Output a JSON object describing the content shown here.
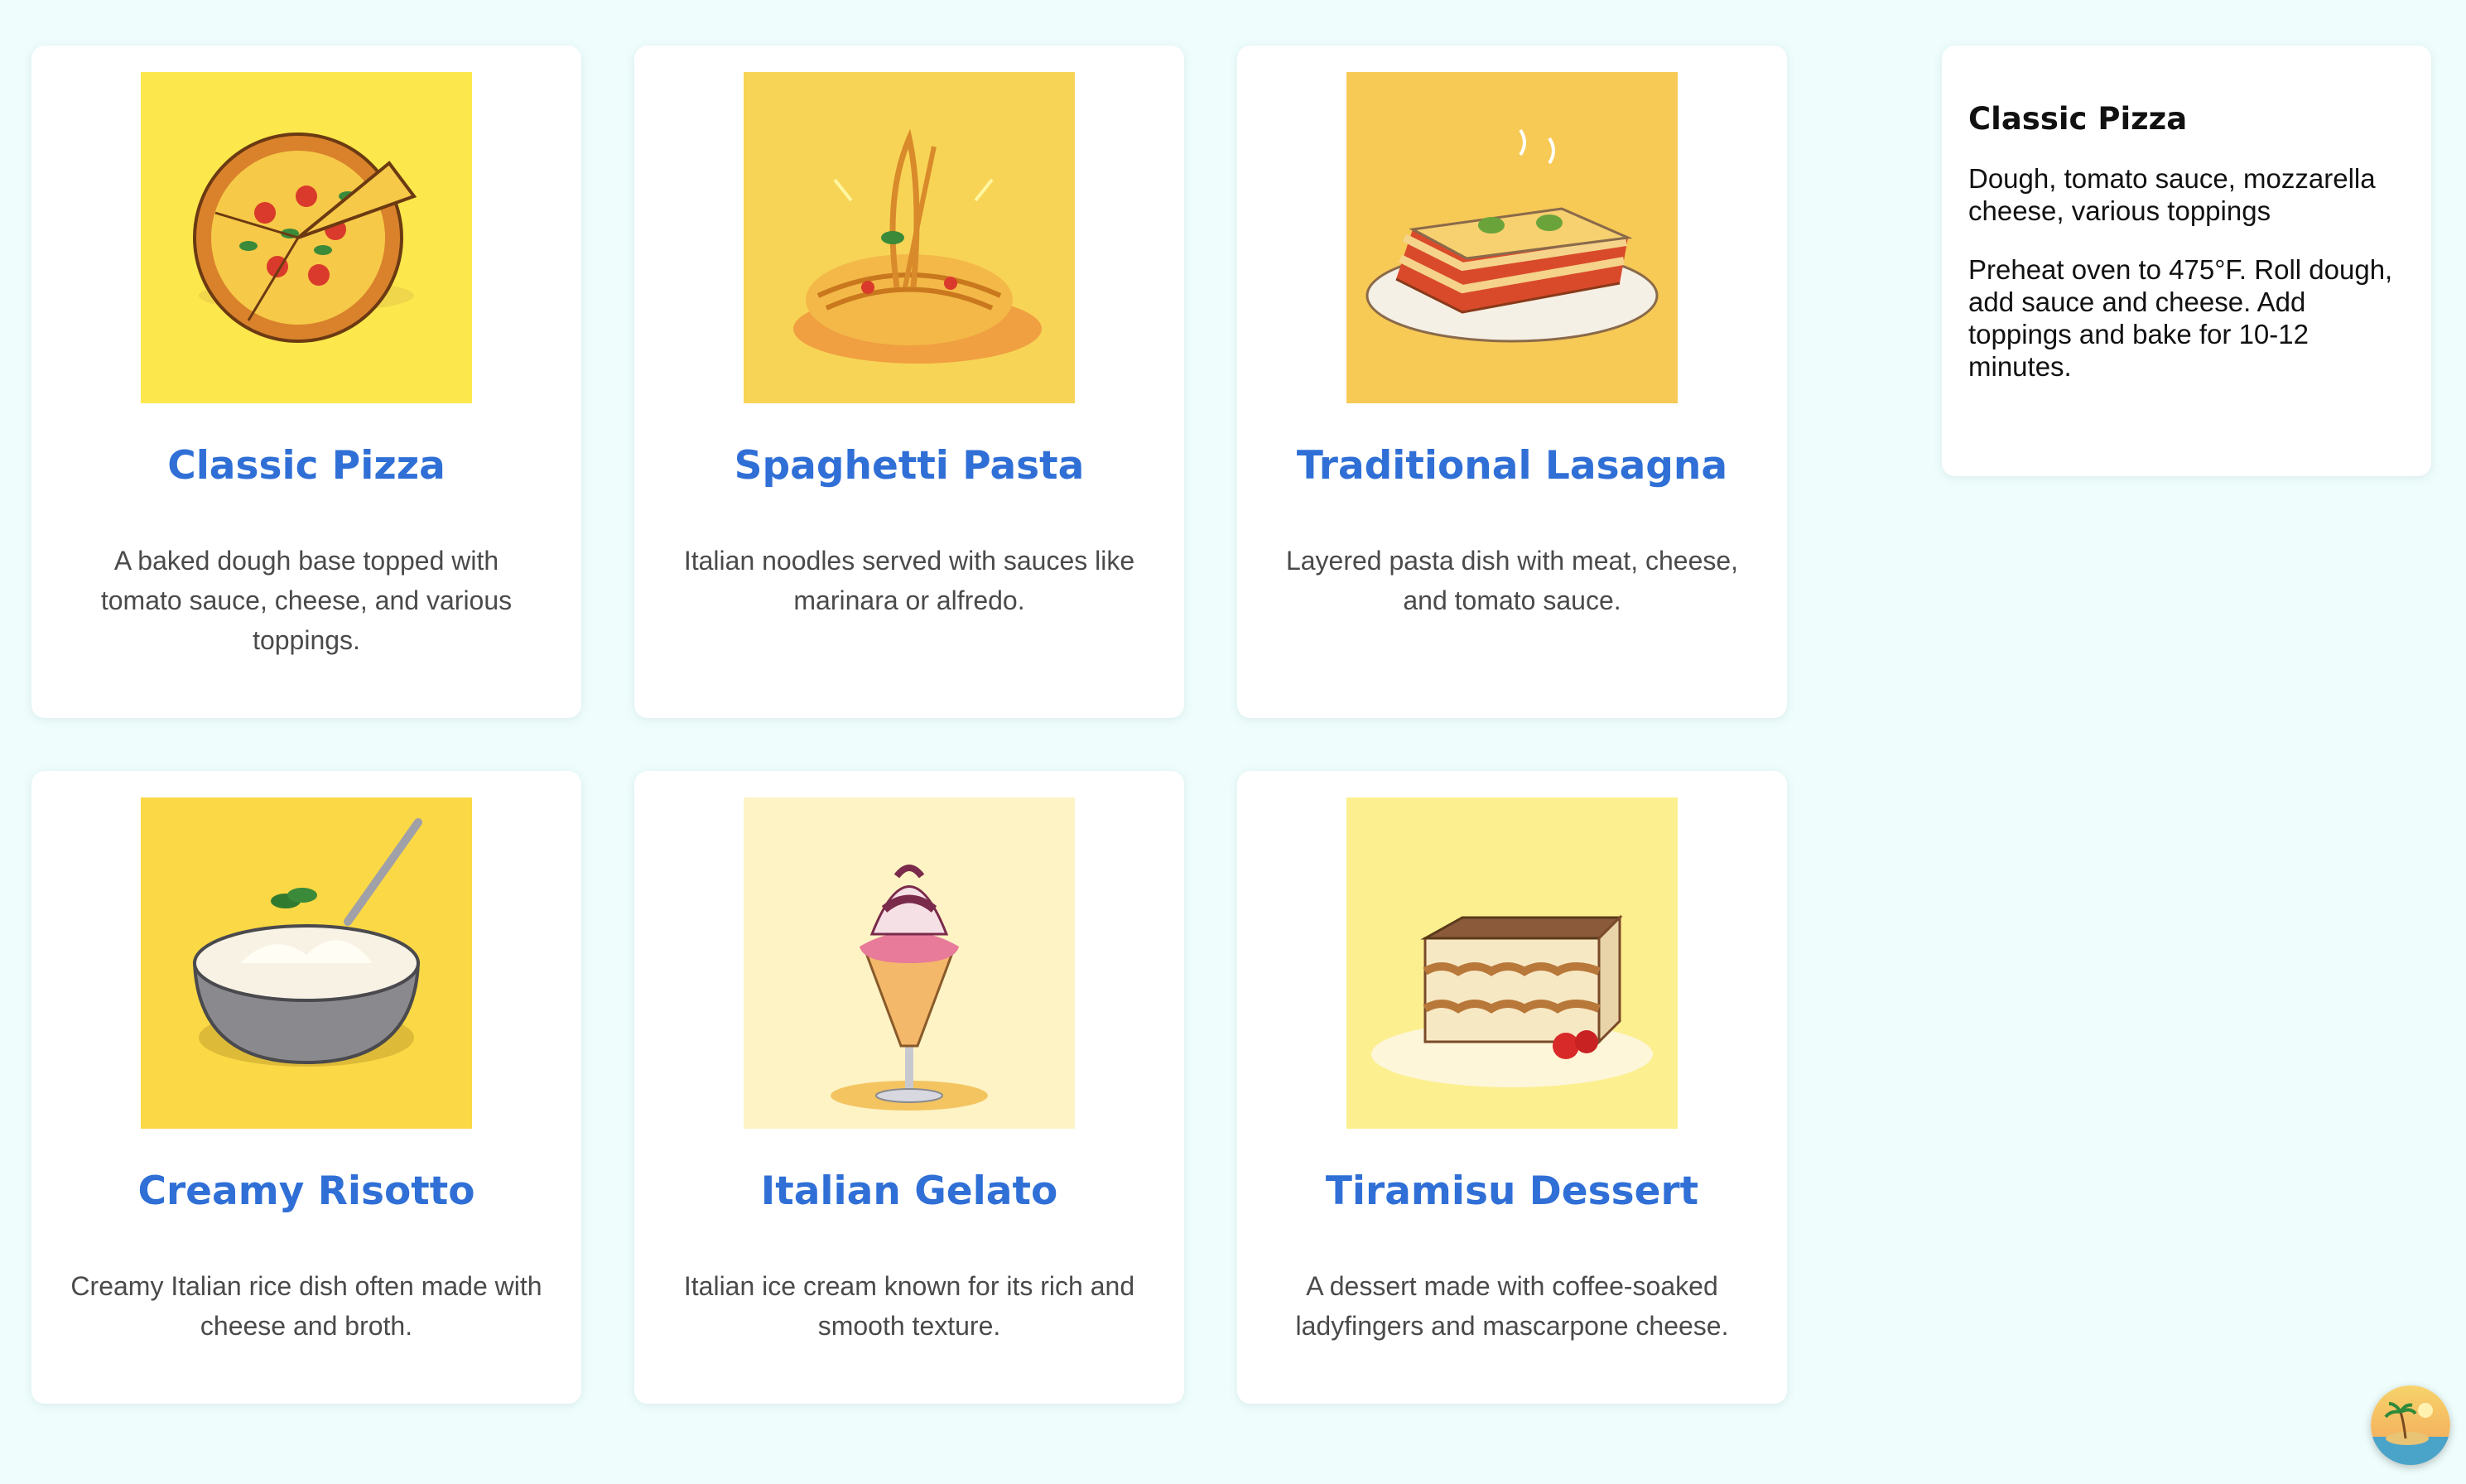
{
  "dishes": [
    {
      "title": "Classic Pizza",
      "description": "A baked dough base topped with tomato sauce, cheese, and various toppings.",
      "image_icon": "pizza-icon",
      "image_bg": "#fce84c"
    },
    {
      "title": "Spaghetti Pasta",
      "description": "Italian noodles served with sauces like marinara or alfredo.",
      "image_icon": "spaghetti-icon",
      "image_bg": "#f8d456"
    },
    {
      "title": "Traditional Lasagna",
      "description": "Layered pasta dish with meat, cheese, and tomato sauce.",
      "image_icon": "lasagna-icon",
      "image_bg": "#f7c955"
    },
    {
      "title": "Creamy Risotto",
      "description": "Creamy Italian rice dish often made with cheese and broth.",
      "image_icon": "risotto-icon",
      "image_bg": "#fbd845"
    },
    {
      "title": "Italian Gelato",
      "description": "Italian ice cream known for its rich and smooth texture.",
      "image_icon": "gelato-icon",
      "image_bg": "#fdf3c4"
    },
    {
      "title": "Tiramisu Dessert",
      "description": "A dessert made with coffee-soaked ladyfingers and mascarpone cheese.",
      "image_icon": "tiramisu-icon",
      "image_bg": "#fcef8f"
    }
  ],
  "detail": {
    "title": "Classic Pizza",
    "ingredients": "Dough, tomato sauce, mozzarella cheese, various toppings",
    "instructions": "Preheat oven to 475°F. Roll dough, add sauce and cheese. Add toppings and bake for 10-12 minutes."
  },
  "fab_icon": "island-avatar-icon",
  "colors": {
    "page_bg": "#effefd",
    "title_blue": "#2f6fd6",
    "card_bg": "#ffffff"
  }
}
